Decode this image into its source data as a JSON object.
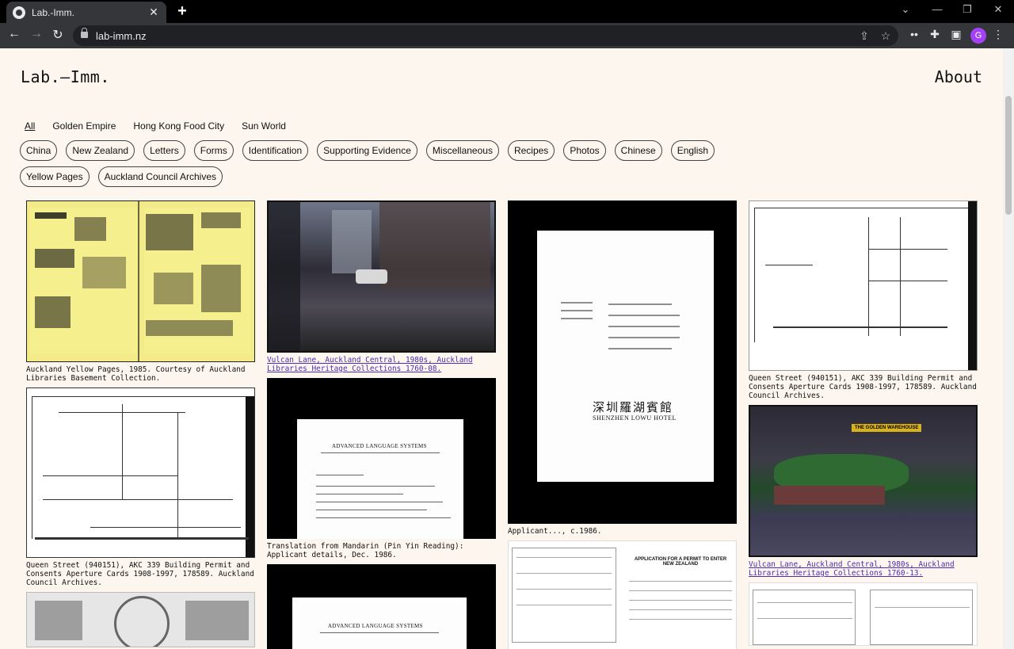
{
  "browser": {
    "tab_title": "Lab.-Imm.",
    "url": "lab-imm.nz",
    "avatar_letter": "G"
  },
  "site": {
    "logo": "Lab.—Imm.",
    "about": "About"
  },
  "collections": [
    "All",
    "Golden Empire",
    "Hong Kong Food City",
    "Sun World"
  ],
  "tags": [
    "China",
    "New Zealand",
    "Letters",
    "Forms",
    "Identification",
    "Supporting Evidence",
    "Miscellaneous",
    "Recipes",
    "Photos",
    "Chinese",
    "English",
    "Yellow Pages",
    "Auckland Council Archives"
  ],
  "captions": {
    "c1_1": "Auckland Yellow Pages, 1985. Courtesy of Auckland Libraries Basement Collection.",
    "c1_2": "Queen Street (940151), AKC 339 Building Permit and Consents Aperture Cards 1908-1997, 178589. Auckland Council Archives.",
    "c2_1": "Vulcan Lane, Auckland Central, 1980s, Auckland Libraries Heritage Collections 1760-08.",
    "c2_2": "Translation from Mandarin (Pin Yin Reading): Applicant details, Dec. 1986.",
    "c3_1": "Applicant..., c.1986.",
    "c4_1": "Queen Street (940151), AKC 339 Building Permit and Consents Aperture Cards 1908-1997, 178589. Auckland Council Archives.",
    "c4_2": "Vulcan Lane, Auckland Central, 1980s, Auckland Libraries Heritage Collections 1760-13."
  },
  "doc_text": {
    "als_title": "ADVANCED LANGUAGE SYSTEMS",
    "hotel_cn": "深圳羅湖賓館",
    "hotel_en": "SHENZHEN LOWU HOTEL",
    "form_title": "APPLICATION FOR A PERMIT TO ENTER NEW ZEALAND",
    "sign_text": "THE GOLDEN WAREHOUSE"
  }
}
